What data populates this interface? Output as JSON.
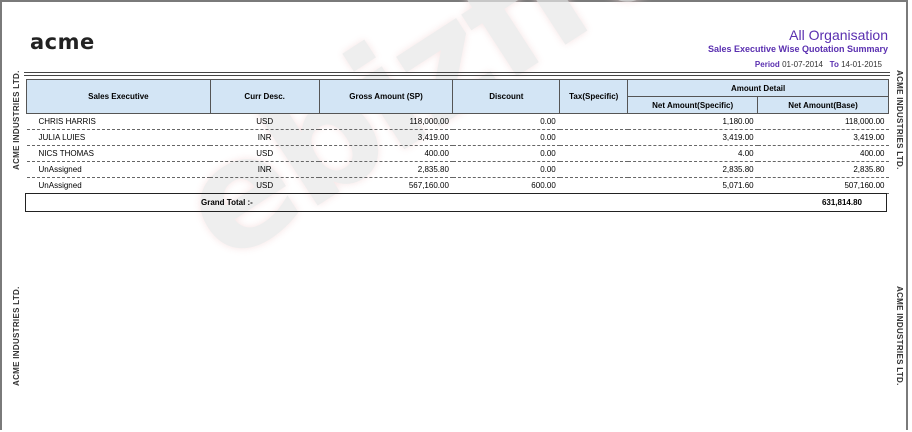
{
  "header": {
    "logo": "acme",
    "organisation": "All Organisation",
    "report_title": "Sales Executive Wise Quotation Summary",
    "period_label": "Period",
    "period_from": "01-07-2014",
    "to_label": "To",
    "period_to": "14-01-2015"
  },
  "side_text": "ACME INDUSTRIES LTD.",
  "watermark": "ebizframe",
  "table": {
    "columns": {
      "sales_executive": "Sales Executive",
      "curr_desc": "Curr Desc.",
      "gross_amount": "Gross Amount (SP)",
      "discount": "Discount",
      "tax": "Tax(Specific)",
      "amount_detail": "Amount Detail",
      "net_specific": "Net Amount(Specific)",
      "net_base": "Net Amount(Base)"
    },
    "rows": [
      {
        "executive": "CHRIS HARRIS",
        "currency": "USD",
        "gross": "118,000.00",
        "discount": "0.00",
        "tax": "",
        "net_specific": "1,180.00",
        "net_base": "118,000.00"
      },
      {
        "executive": "JULIA LUIES",
        "currency": "INR",
        "gross": "3,419.00",
        "discount": "0.00",
        "tax": "",
        "net_specific": "3,419.00",
        "net_base": "3,419.00"
      },
      {
        "executive": "NICS THOMAS",
        "currency": "USD",
        "gross": "400.00",
        "discount": "0.00",
        "tax": "",
        "net_specific": "4.00",
        "net_base": "400.00"
      },
      {
        "executive": "UnAssigned",
        "currency": "INR",
        "gross": "2,835.80",
        "discount": "0.00",
        "tax": "",
        "net_specific": "2,835.80",
        "net_base": "2,835.80"
      },
      {
        "executive": "UnAssigned",
        "currency": "USD",
        "gross": "567,160.00",
        "discount": "600.00",
        "tax": "",
        "net_specific": "5,071.60",
        "net_base": "507,160.00"
      }
    ],
    "grand_total_label": "Grand Total  :-",
    "grand_total_value": "631,814.80"
  },
  "colors": {
    "accent": "#5a2fb0",
    "header_fill": "#d3e5f5"
  }
}
